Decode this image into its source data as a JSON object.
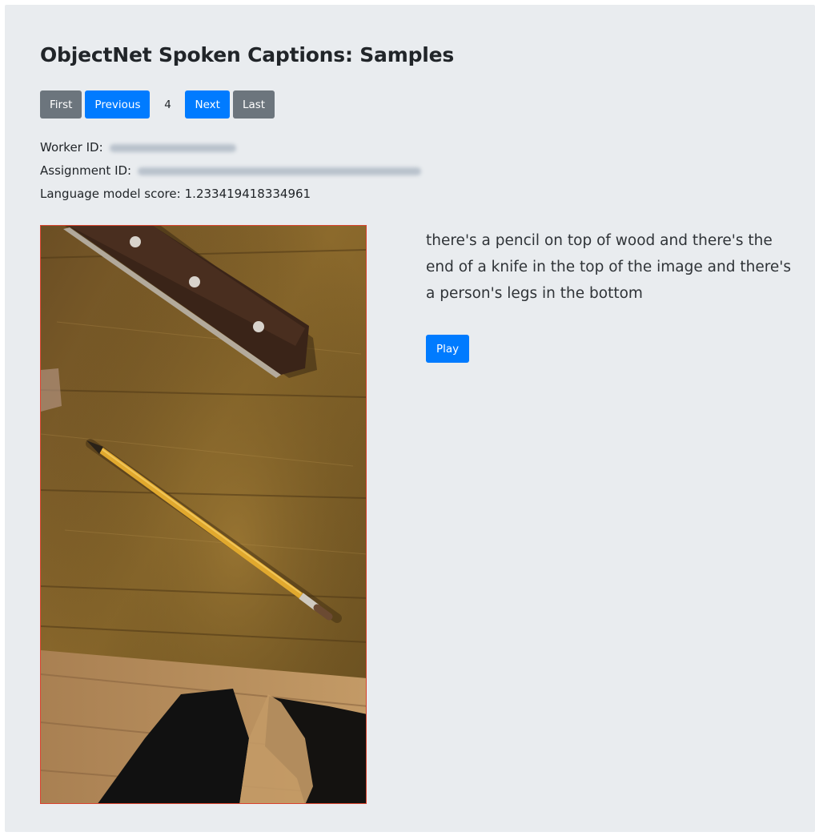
{
  "page": {
    "title": "ObjectNet Spoken Captions: Samples"
  },
  "pager": {
    "first_label": "First",
    "previous_label": "Previous",
    "current_page": "4",
    "next_label": "Next",
    "last_label": "Last"
  },
  "meta": {
    "worker_id_label": "Worker ID:",
    "assignment_id_label": "Assignment ID:",
    "lm_score_label": "Language model score:",
    "lm_score_value": "1.233419418334961"
  },
  "sample": {
    "caption": "there's a pencil on top of wood and there's the end of a knife in the top of the image and there's a person's legs in the bottom",
    "play_label": "Play"
  },
  "colors": {
    "primary": "#007bff",
    "secondary": "#6c757d",
    "background": "#e9ecef",
    "image_border": "#d9432e"
  }
}
